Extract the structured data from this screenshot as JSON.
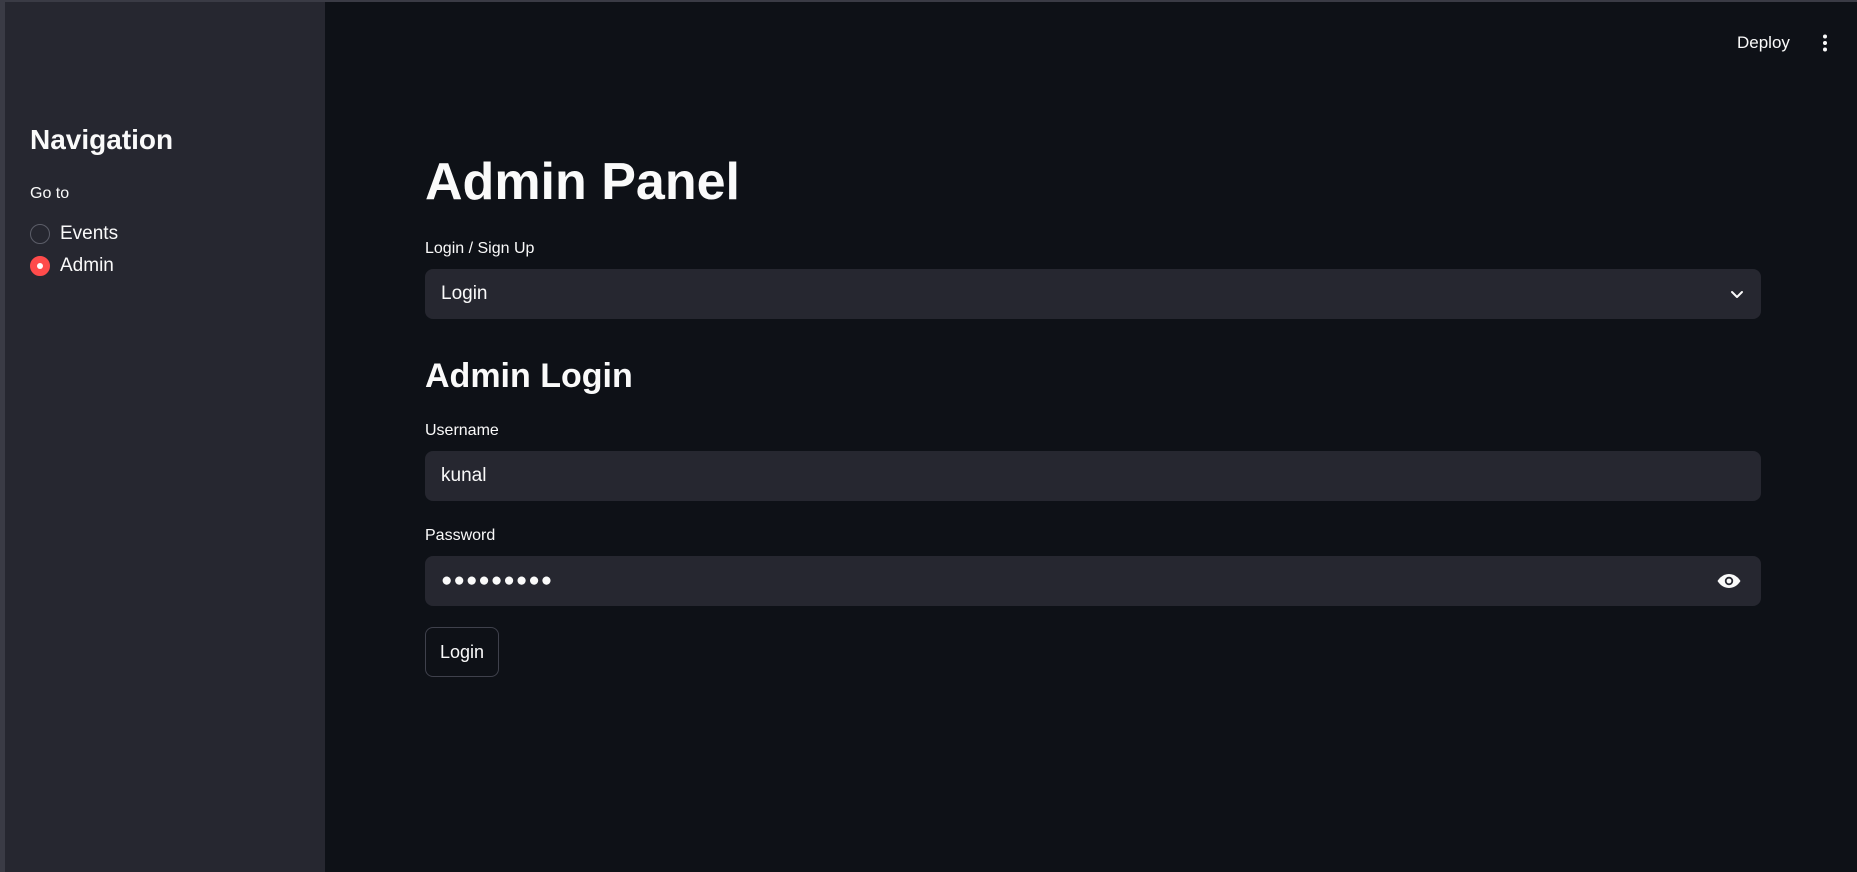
{
  "header": {
    "deploy_label": "Deploy",
    "menu_icon": "kebab-menu-icon"
  },
  "sidebar": {
    "title": "Navigation",
    "radio_label": "Go to",
    "options": [
      {
        "label": "Events",
        "selected": false
      },
      {
        "label": "Admin",
        "selected": true
      }
    ],
    "accent_color": "#ff4b4b"
  },
  "main": {
    "title": "Admin Panel",
    "mode_select": {
      "label": "Login / Sign Up",
      "value": "Login",
      "icon": "chevron-down-icon"
    },
    "section_title": "Admin Login",
    "username": {
      "label": "Username",
      "value": "kunal"
    },
    "password": {
      "label": "Password",
      "masked_value": "●●●●●●●●●",
      "icon": "eye-icon"
    },
    "login_button_label": "Login"
  },
  "colors": {
    "background": "#0e1117",
    "sidebar_background": "#262730",
    "input_background": "#262730",
    "text": "#fafafa"
  }
}
